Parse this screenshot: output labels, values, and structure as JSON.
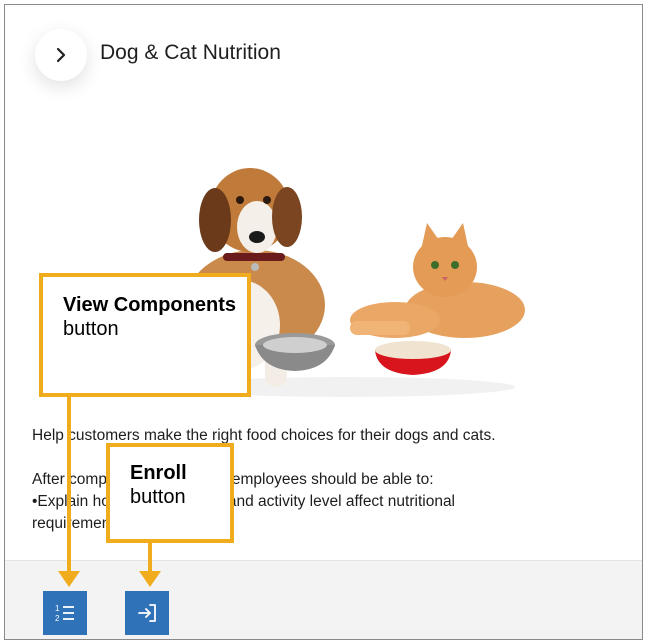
{
  "header": {
    "title": "Dog & Cat Nutrition"
  },
  "description": {
    "intro": "Help customers make the right food choices for their dogs and cats.",
    "line2": "After completing this course, employees should be able to:",
    "bullet1": "•Explain how life stage, size and activity level affect nutritional",
    "bullet1_cont": "requirements."
  },
  "hero": {
    "alt": ""
  },
  "toolbar": {
    "view_components_icon": "numbered-list-icon",
    "enroll_icon": "sign-in-arrow-icon"
  },
  "callouts": {
    "view_components": {
      "bold": "View Components",
      "rest": "button"
    },
    "enroll": {
      "bold": "Enroll",
      "rest": "button"
    }
  },
  "colors": {
    "accent": "#2f72b8",
    "callout": "#f0ac1c"
  }
}
